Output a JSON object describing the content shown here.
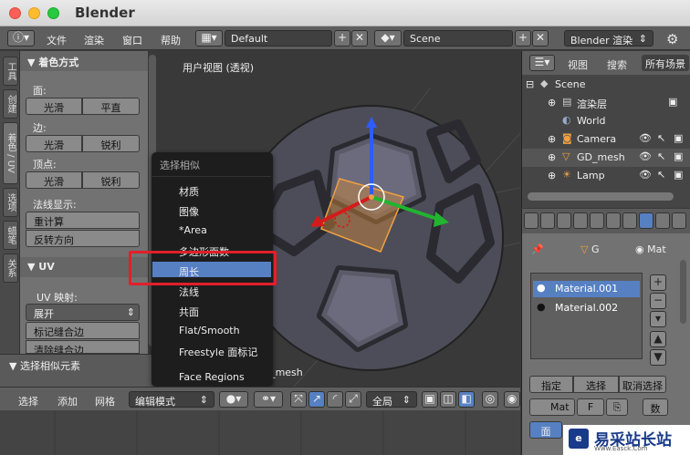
{
  "window": {
    "title": "Blender"
  },
  "menubar": {
    "items": [
      "文件",
      "渲染",
      "窗口",
      "帮助"
    ],
    "layout": "Default",
    "scene": "Scene",
    "engine": "Blender 渲染"
  },
  "lefttabs": [
    "工具",
    "创建",
    "着色 / UV",
    "选项",
    "蜡笔",
    "关系"
  ],
  "shading": {
    "header": "▼ 着色方式",
    "face_label": "面:",
    "face_buttons": [
      "光滑",
      "平直"
    ],
    "edge_label": "边:",
    "edge_buttons": [
      "光滑",
      "锐利"
    ],
    "vertex_label": "顶点:",
    "vertex_buttons": [
      "光滑",
      "锐利"
    ],
    "normals_label": "法线显示:",
    "normal_buttons": [
      "重计算",
      "反转方向"
    ]
  },
  "uv": {
    "header": "▼ UV",
    "map_label": "UV 映射:",
    "unwrap": "展开",
    "mark_seam": "标记缝合边",
    "clear_seam": "清除缝合边"
  },
  "redo_panel": {
    "header": "▼ 选择相似元素"
  },
  "viewport": {
    "title": "用户视图 (透视)",
    "object_label": "(1) GD_mesh"
  },
  "popup": {
    "title": "选择相似",
    "items": [
      "材质",
      "图像",
      "*Area",
      "多边形面数",
      "周长",
      "法线",
      "共面",
      "Flat/Smooth",
      "Freestyle 面标记",
      "Face Regions"
    ],
    "selected_index": 4
  },
  "bottombar": {
    "items": [
      "选择",
      "添加",
      "网格"
    ],
    "mode": "编辑模式",
    "pivot": "全局"
  },
  "outliner": {
    "tabs": [
      "视图",
      "搜索",
      "所有场景"
    ],
    "rows": [
      "Scene",
      "渲染层",
      "World",
      "Camera",
      "GD_mesh",
      "Lamp"
    ]
  },
  "properties": {
    "breadcrumb": [
      "G",
      "Mat"
    ],
    "materials": [
      "Material.001",
      "Material.002"
    ],
    "buttons": [
      "指定",
      "选择",
      "取消选择"
    ],
    "mat_field": "Mat",
    "f_label": "F",
    "data_label": "数",
    "face_tab": "面"
  },
  "watermark": {
    "text": "易采站长站",
    "sub": "Www.Easck.Com"
  },
  "colors": {
    "accent": "#5680c2",
    "highlight_box": "#e0202a"
  }
}
